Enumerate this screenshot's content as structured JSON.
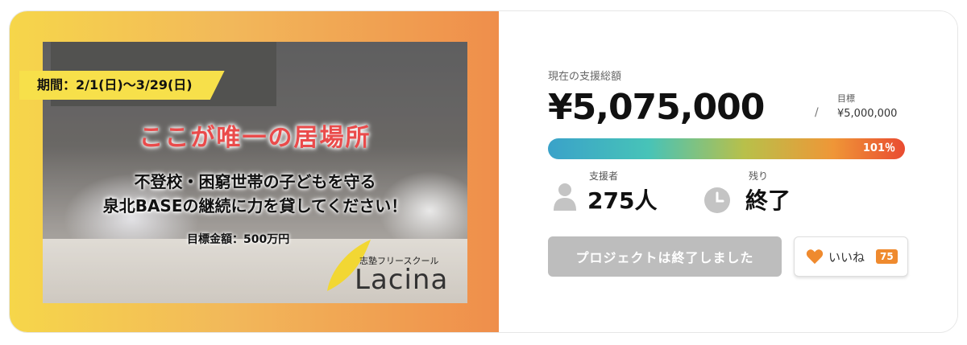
{
  "banner": {
    "period": "期間：2/1(日)〜3/29(日)",
    "catchphrase": "ここが唯一の居場所",
    "subtitle_line1": "不登校・困窮世帯の子どもを守る",
    "subtitle_line2": "泉北BASEの継続に力を貸してください！",
    "goal_note": "目標金額：500万円",
    "logo_subtitle": "志塾フリースクール",
    "logo_name": "Lacina"
  },
  "funding": {
    "current_label": "現在の支援総額",
    "current_amount": "¥5,075,000",
    "slash": "/",
    "target_label": "目標",
    "target_amount": "¥5,000,000",
    "progress_percent": "101％",
    "progress_value": 101
  },
  "stats": {
    "supporters_label": "支援者",
    "supporters_value": "275人",
    "remaining_label": "残り",
    "remaining_value": "終了"
  },
  "actions": {
    "ended_label": "プロジェクトは終了しました",
    "like_label": "いいね",
    "like_count": "75"
  },
  "colors": {
    "accent_orange": "#ef8a2e",
    "catch_red": "#ea4b4b",
    "period_yellow": "#f7e04a",
    "disabled_gray": "#bdbdbd"
  },
  "icons": {
    "supporters": "person-icon",
    "remaining": "clock-icon",
    "like": "heart-icon",
    "logo": "leaf-icon"
  }
}
